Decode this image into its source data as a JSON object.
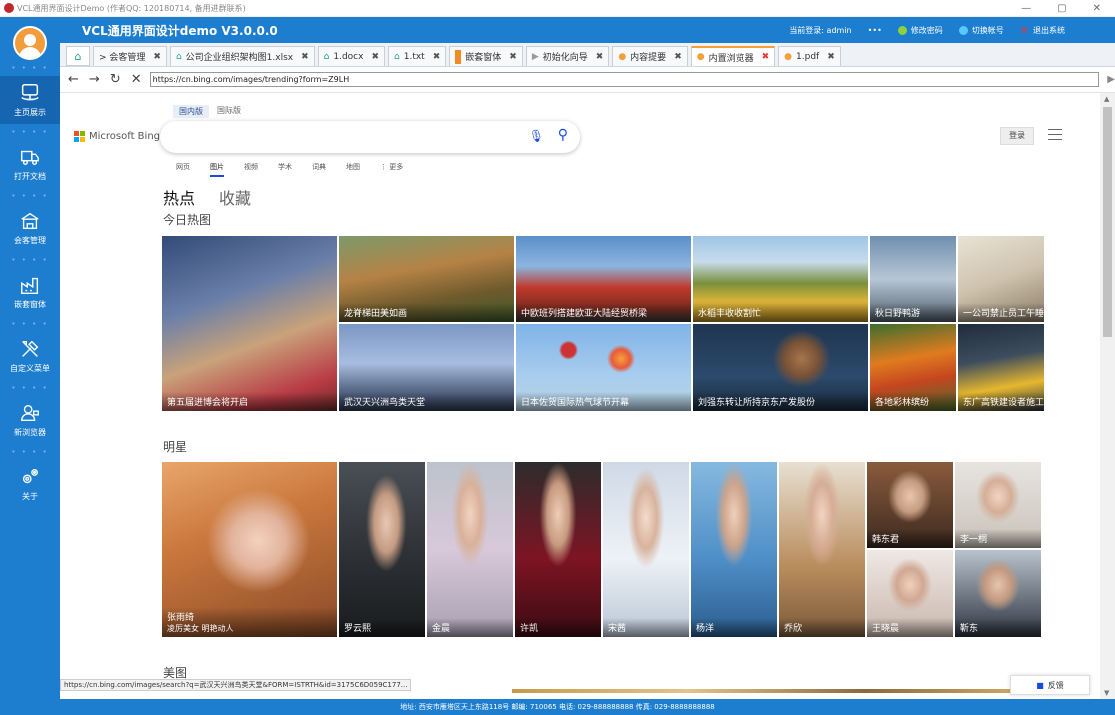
{
  "window": {
    "title": "VCL通用界面设计Demo (作者QQ: 120180714, 备用进群联系)",
    "controls": [
      "—",
      "▢",
      "✕"
    ]
  },
  "sidebar": {
    "items": [
      {
        "label": "主页展示",
        "icon": "monitor-icon"
      },
      {
        "label": "打开文档",
        "icon": "truck-icon"
      },
      {
        "label": "会客管理",
        "icon": "building-icon"
      },
      {
        "label": "嵌套窗体",
        "icon": "factory-icon"
      },
      {
        "label": "自定义菜单",
        "icon": "tools-icon"
      },
      {
        "label": "新浏览器",
        "icon": "user-icon"
      },
      {
        "label": "关于",
        "icon": "gears-icon"
      }
    ]
  },
  "header": {
    "app_title": "VCL通用界面设计demo V3.0.0.0",
    "login_info": "当前登录: admin",
    "more": "•••",
    "change_pwd": "修改密码",
    "switch_account": "切换帐号",
    "exit": "退出系统"
  },
  "tabs": [
    {
      "label": "> 会客管理",
      "icon": ""
    },
    {
      "label": "公司企业组织架构图1.xlsx",
      "icon": "home-icon"
    },
    {
      "label": "1.docx",
      "icon": "home-icon"
    },
    {
      "label": "1.txt",
      "icon": "home-icon"
    },
    {
      "label": "嵌套窗体",
      "icon": "orange-bar-icon"
    },
    {
      "label": "初始化向导",
      "icon": "play-icon"
    },
    {
      "label": "内容提要",
      "icon": "dot-icon"
    },
    {
      "label": "内置浏览器",
      "icon": "dot-icon",
      "active": true
    },
    {
      "label": "1.pdf",
      "icon": "dot-icon"
    }
  ],
  "browser": {
    "url": "https://cn.bing.com/images/trending?form=Z9LH",
    "status_url": "https://cn.bing.com/images/search?q=武汉天兴洲鸟类天堂&FORM=ISTRTH&id=3175C6D059C177..."
  },
  "bing": {
    "region_tabs": [
      "国内版",
      "国际版"
    ],
    "logo_text": "Microsoft Bing",
    "login": "登录",
    "verticals": [
      "网页",
      "图片",
      "视频",
      "学术",
      "词典",
      "地图",
      "⋮ 更多"
    ],
    "hot_label": "热点",
    "fav_label": "收藏",
    "section_today": "今日热图",
    "section_stars": "明星",
    "section_beauty": "美图",
    "feedback": "反馈",
    "today": [
      "第五届进博会将开启",
      "龙脊梯田美如画",
      "中欧班列搭建欧亚大陆经贸桥梁",
      "水稻丰收收割忙",
      "秋日野鸭游",
      "一公司禁止员工午睡",
      "武汉天兴洲鸟类天堂",
      "日本佐贺国际热气球节开幕",
      "刘强东转让所持京东产发股份",
      "各地彩林缤纷",
      "东广高铁建设者施工忙"
    ],
    "stars": [
      {
        "name": "张雨绮",
        "sub": "凌厉美女 明艳动人"
      },
      {
        "name": "罗云熙"
      },
      {
        "name": "金晨"
      },
      {
        "name": "许凯"
      },
      {
        "name": "宋茜"
      },
      {
        "name": "杨洋"
      },
      {
        "name": "乔欣"
      },
      {
        "name": "韩东君"
      },
      {
        "name": "李一桐"
      },
      {
        "name": "王晓晨"
      },
      {
        "name": "靳东"
      }
    ]
  },
  "footer": "地址: 西安市雁塔区天上东路118号  邮编: 710065  电话: 029-888888888  传真: 029-8888888888"
}
